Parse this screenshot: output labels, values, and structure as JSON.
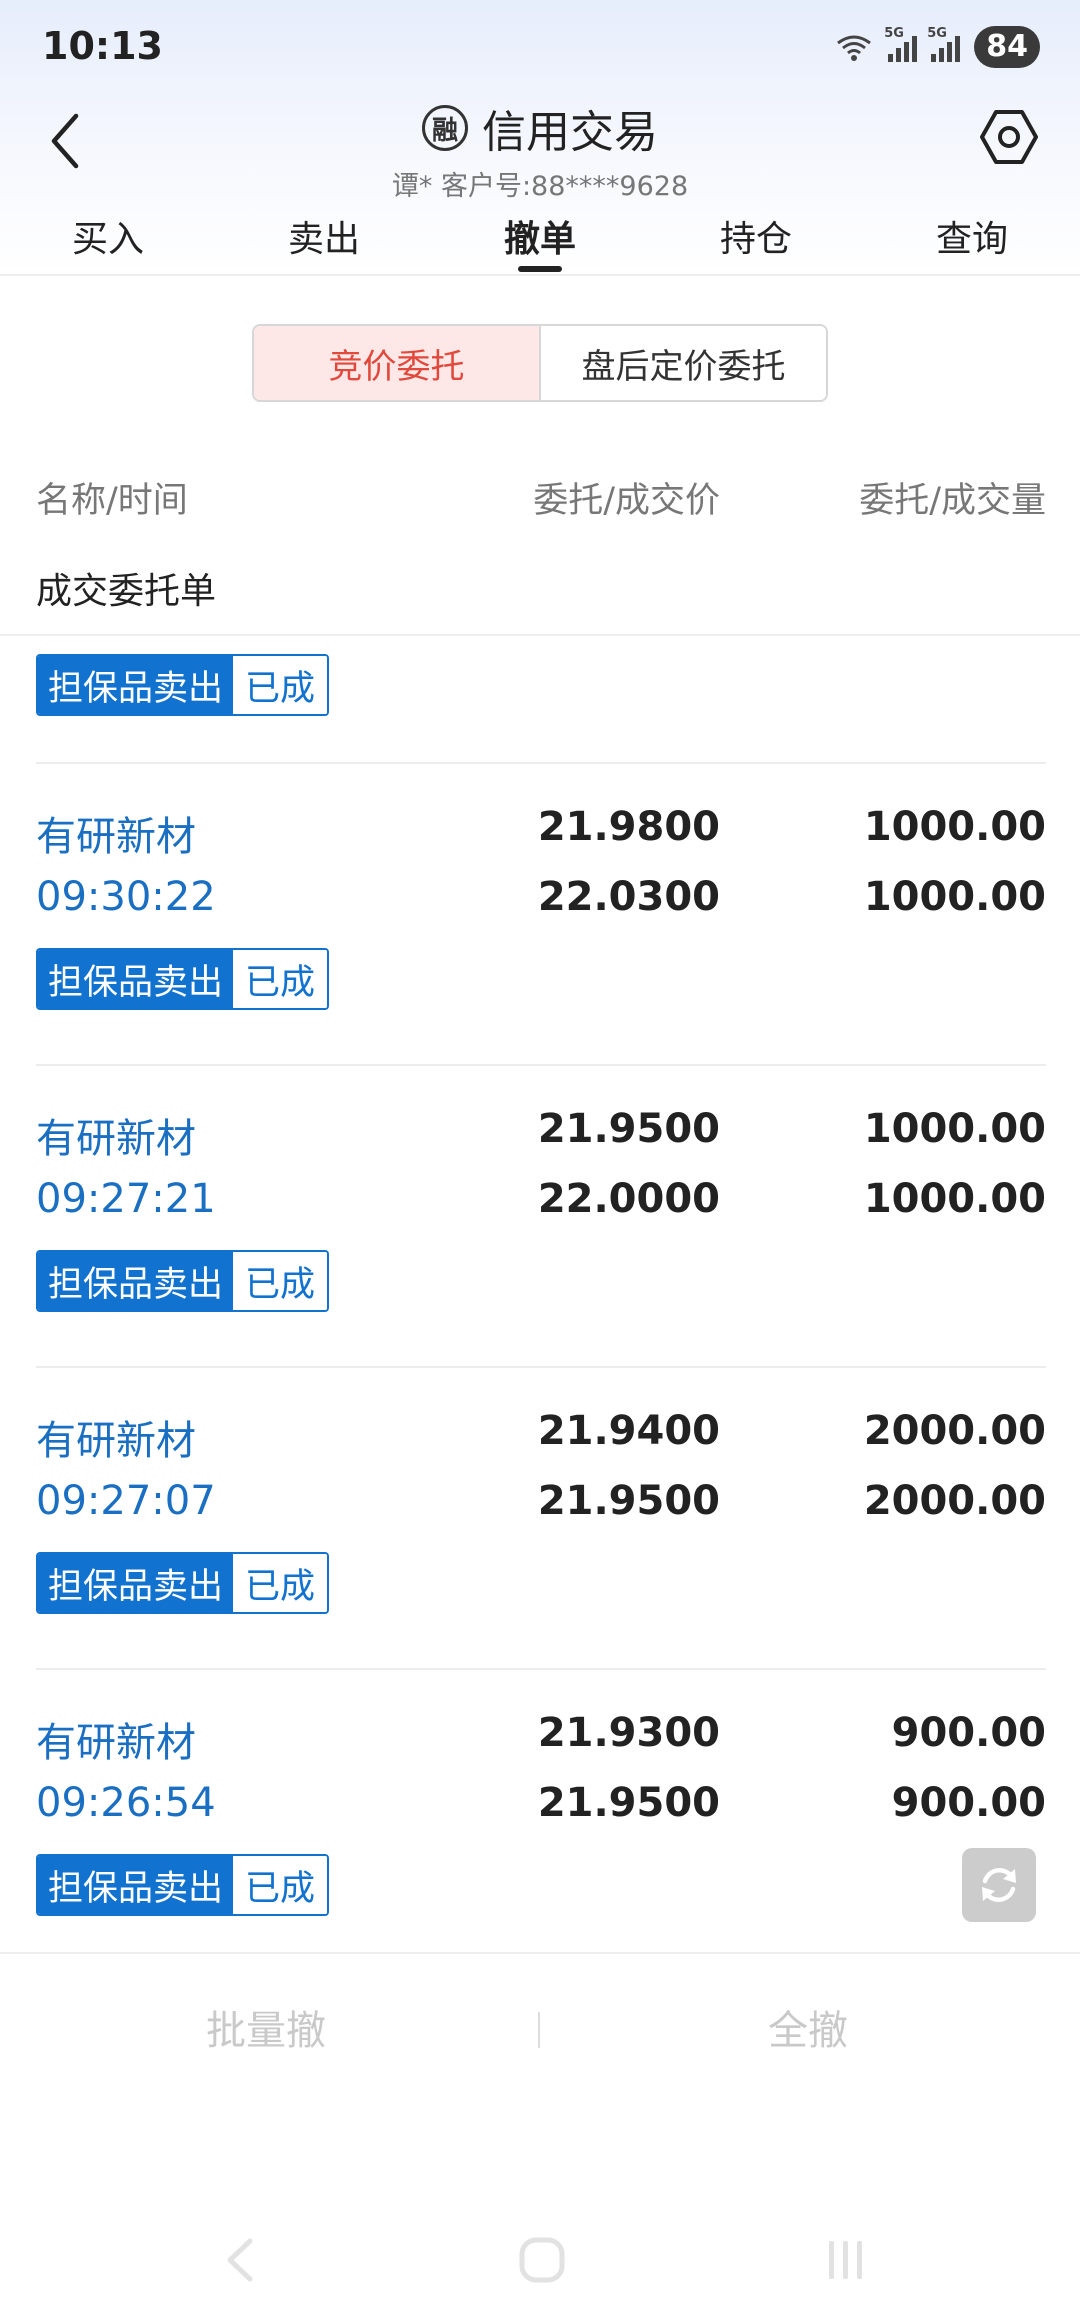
{
  "status_bar": {
    "time": "10:13",
    "battery": "84",
    "sig1_tag": "5G",
    "sig2_tag": "5G"
  },
  "header": {
    "title": "信用交易",
    "title_icon_glyph": "融",
    "subtitle": "谭*  客户号:88****9628"
  },
  "tabs": [
    {
      "label": "买入"
    },
    {
      "label": "卖出"
    },
    {
      "label": "撤单",
      "active": true
    },
    {
      "label": "持仓"
    },
    {
      "label": "查询"
    }
  ],
  "segment": {
    "options": [
      {
        "label": "竞价委托",
        "active": true
      },
      {
        "label": "盘后定价委托"
      }
    ]
  },
  "columns": {
    "name_time": "名称/时间",
    "price": "委托/成交价",
    "qty": "委托/成交量"
  },
  "section": {
    "title": "成交委托单",
    "first_tag_type": "担保品卖出",
    "first_tag_status": "已成"
  },
  "orders": [
    {
      "name": "有研新材",
      "time": "09:30:22",
      "order_price": "21.9800",
      "deal_price": "22.0300",
      "order_qty": "1000.00",
      "deal_qty": "1000.00",
      "type": "担保品卖出",
      "status": "已成"
    },
    {
      "name": "有研新材",
      "time": "09:27:21",
      "order_price": "21.9500",
      "deal_price": "22.0000",
      "order_qty": "1000.00",
      "deal_qty": "1000.00",
      "type": "担保品卖出",
      "status": "已成"
    },
    {
      "name": "有研新材",
      "time": "09:27:07",
      "order_price": "21.9400",
      "deal_price": "21.9500",
      "order_qty": "2000.00",
      "deal_qty": "2000.00",
      "type": "担保品卖出",
      "status": "已成"
    },
    {
      "name": "有研新材",
      "time": "09:26:54",
      "order_price": "21.9300",
      "deal_price": "21.9500",
      "order_qty": "900.00",
      "deal_qty": "900.00",
      "type": "担保品卖出",
      "status": "已成"
    }
  ],
  "actions": {
    "batch_cancel": "批量撤",
    "cancel_all": "全撤"
  },
  "colors": {
    "accent_blue": "#1272d0",
    "active_red": "#e0493c",
    "active_bg": "#fde7e7",
    "disabled_text": "#c9c9c9"
  }
}
